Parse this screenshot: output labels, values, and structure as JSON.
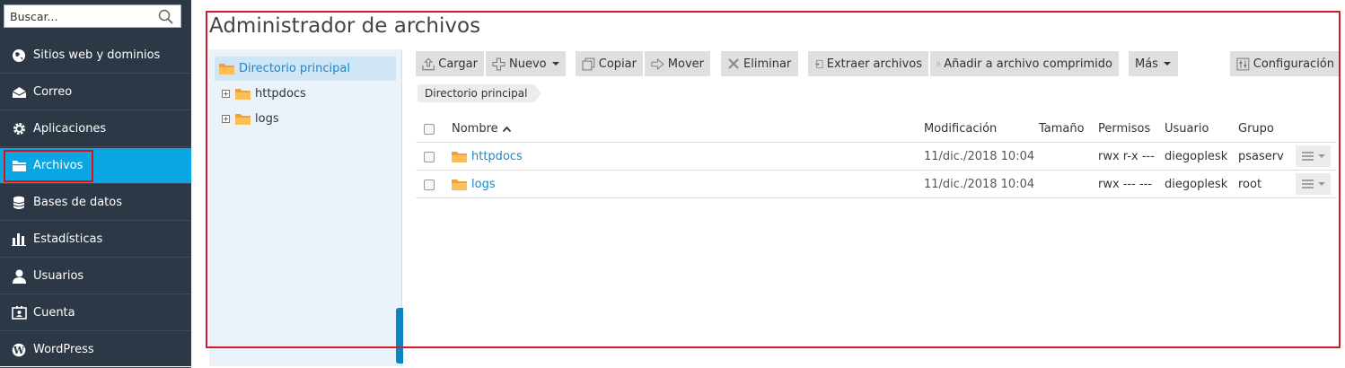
{
  "search": {
    "placeholder": "Buscar..."
  },
  "sidebar": {
    "items": [
      {
        "label": "Sitios web y dominios",
        "icon": "globe-icon"
      },
      {
        "label": "Correo",
        "icon": "envelope-icon"
      },
      {
        "label": "Aplicaciones",
        "icon": "gear-icon"
      },
      {
        "label": "Archivos",
        "icon": "folder-icon",
        "active": true
      },
      {
        "label": "Bases de datos",
        "icon": "database-icon"
      },
      {
        "label": "Estadísticas",
        "icon": "bar-chart-icon"
      },
      {
        "label": "Usuarios",
        "icon": "user-icon"
      },
      {
        "label": "Cuenta",
        "icon": "account-card-icon"
      },
      {
        "label": "WordPress",
        "icon": "wordpress-icon"
      }
    ]
  },
  "page": {
    "title": "Administrador de archivos"
  },
  "tree": {
    "root": "Directorio principal",
    "children": [
      "httpdocs",
      "logs"
    ]
  },
  "toolbar": {
    "upload": "Cargar",
    "new": "Nuevo",
    "copy": "Copiar",
    "move": "Mover",
    "delete": "Eliminar",
    "extract": "Extraer archivos",
    "archive": "Añadir a archivo comprimido",
    "more": "Más",
    "settings": "Configuración"
  },
  "breadcrumb": "Directorio principal",
  "table": {
    "columns": {
      "name": "Nombre",
      "modified": "Modificación",
      "size": "Tamaño",
      "perms": "Permisos",
      "user": "Usuario",
      "group": "Grupo"
    },
    "rows": [
      {
        "name": "httpdocs",
        "modified": "11/dic./2018 10:04",
        "size": "",
        "perms": "rwx r-x ---",
        "user": "diegoplesk",
        "group": "psaserv"
      },
      {
        "name": "logs",
        "modified": "11/dic./2018 10:04",
        "size": "",
        "perms": "rwx --- ---",
        "user": "diegoplesk",
        "group": "root"
      }
    ]
  },
  "colors": {
    "sidebar_bg": "#2c3845",
    "active": "#0aa6e3",
    "link": "#1e88c9",
    "highlight": "#d11a2a",
    "folder": "#f5a030"
  }
}
